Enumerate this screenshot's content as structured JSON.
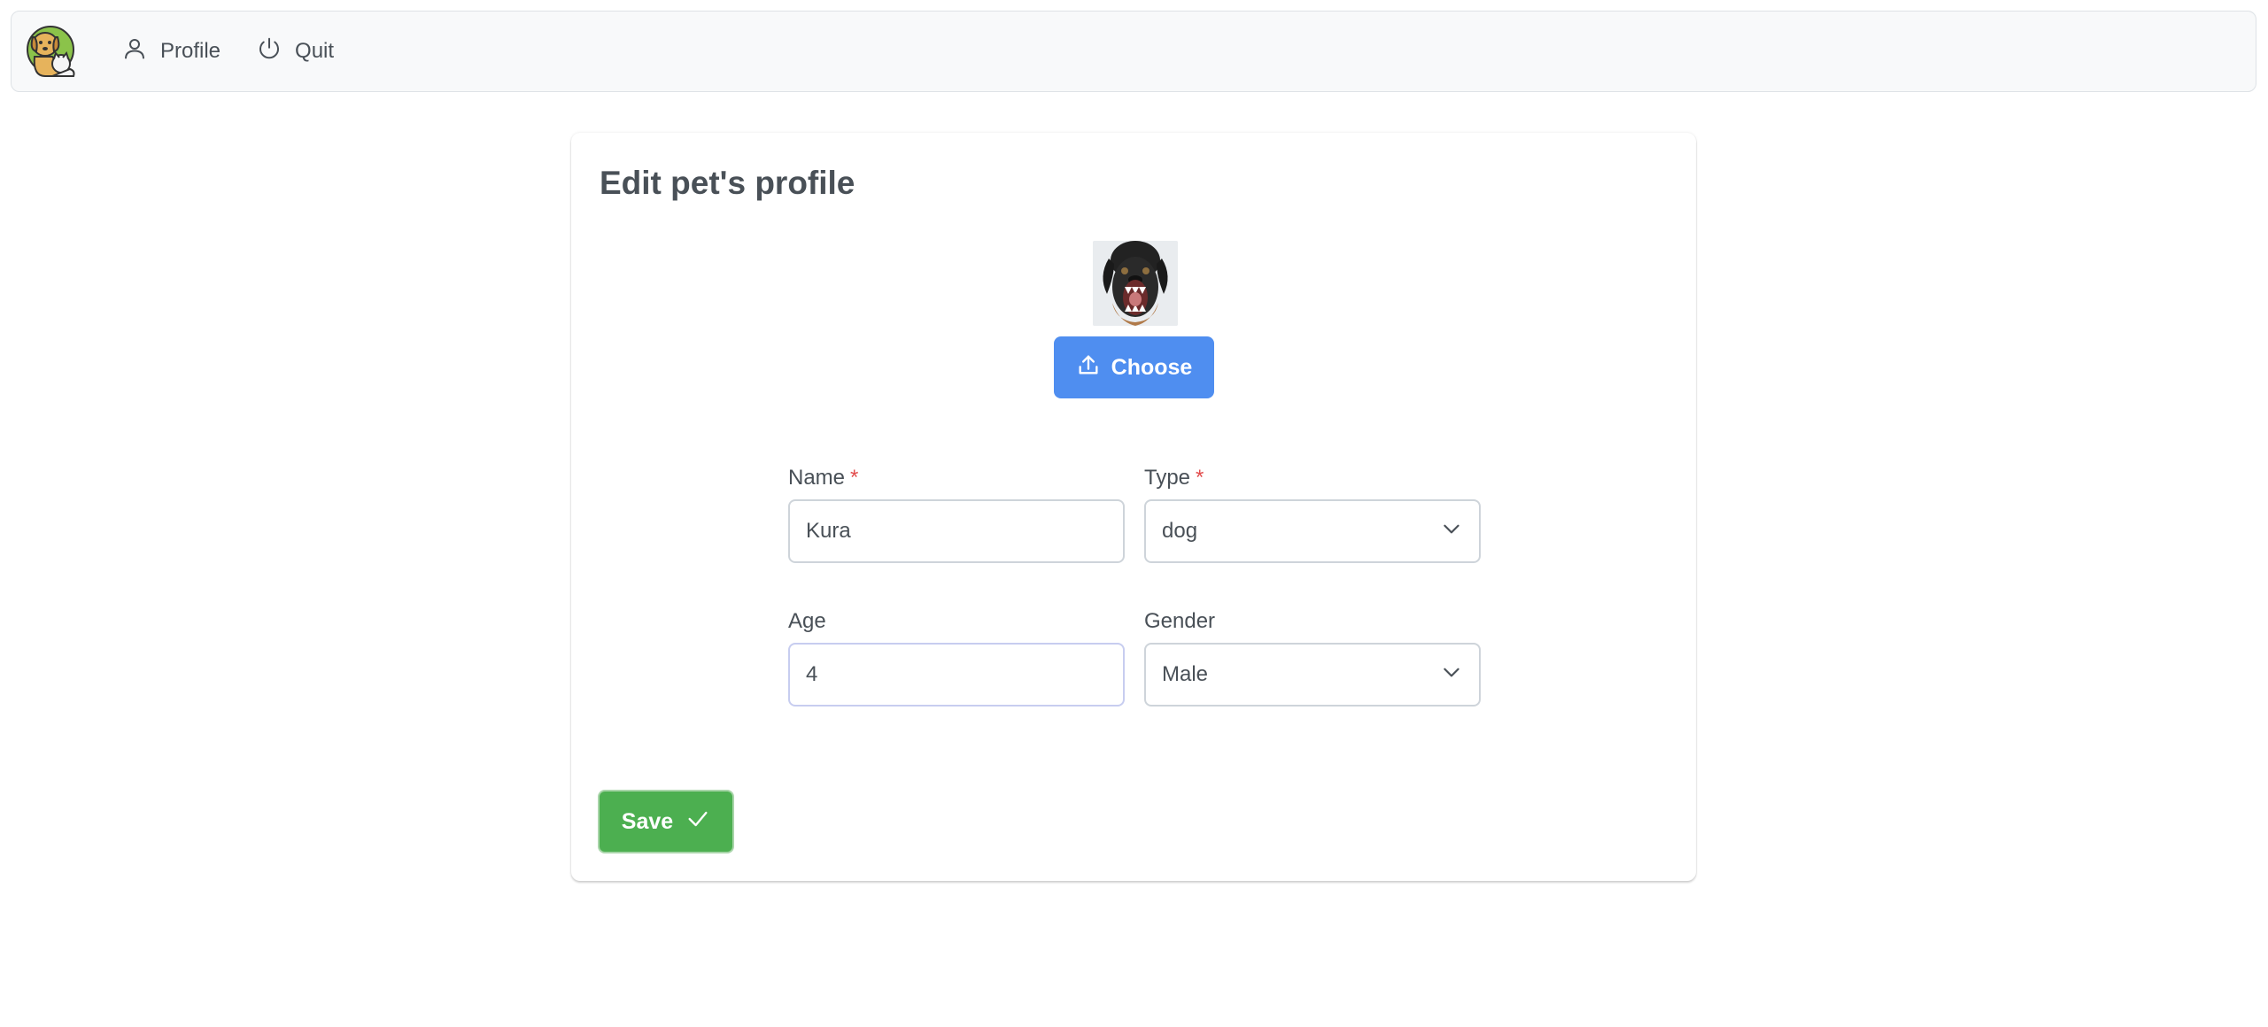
{
  "menubar": {
    "logo_icon": "dog-and-cat-logo",
    "items": [
      {
        "label": "Profile",
        "icon": "user-icon"
      },
      {
        "label": "Quit",
        "icon": "power-icon"
      }
    ]
  },
  "card": {
    "title": "Edit pet's profile",
    "avatar_icon": "pet-photo",
    "choose_label": "Choose",
    "fields": {
      "name": {
        "label": "Name",
        "required_mark": "*",
        "value": "Kura"
      },
      "type": {
        "label": "Type",
        "required_mark": "*",
        "value": "dog"
      },
      "age": {
        "label": "Age",
        "value": "4"
      },
      "gender": {
        "label": "Gender",
        "value": "Male"
      }
    },
    "save_label": "Save"
  },
  "colors": {
    "primary": "#4f8ef0",
    "success": "#4caf50",
    "required": "#e24c4c",
    "text": "#495057"
  }
}
